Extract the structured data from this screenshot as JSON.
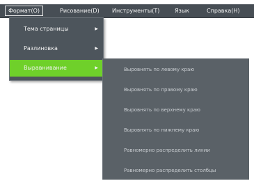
{
  "menubar": {
    "items": [
      {
        "label": "Формат(O)"
      },
      {
        "label": "Рисование(D)"
      },
      {
        "label": "Инструменты(T)"
      },
      {
        "label": "Язык"
      },
      {
        "label": "Справка(H)"
      }
    ]
  },
  "format_menu": {
    "items": [
      {
        "label": "Тема страницы"
      },
      {
        "label": "Разлиновка"
      },
      {
        "label": "Выравнивание"
      }
    ],
    "arrow_glyph": "▶"
  },
  "align_submenu": {
    "items": [
      {
        "label": "Выровнять по левому краю"
      },
      {
        "label": "Выровнять по правому краю"
      },
      {
        "label": "Выровнять по верхнему краю"
      },
      {
        "label": "Выровнять по нижнему краю"
      },
      {
        "label": "Равномерно распределить линии"
      },
      {
        "label": "Равномерно распределить столбцы"
      }
    ]
  },
  "colors": {
    "menubar_bg": "#474e55",
    "highlight": "#6fd02a",
    "menu_bg": "#4d555c",
    "submenu_bg": "#5a6167"
  }
}
